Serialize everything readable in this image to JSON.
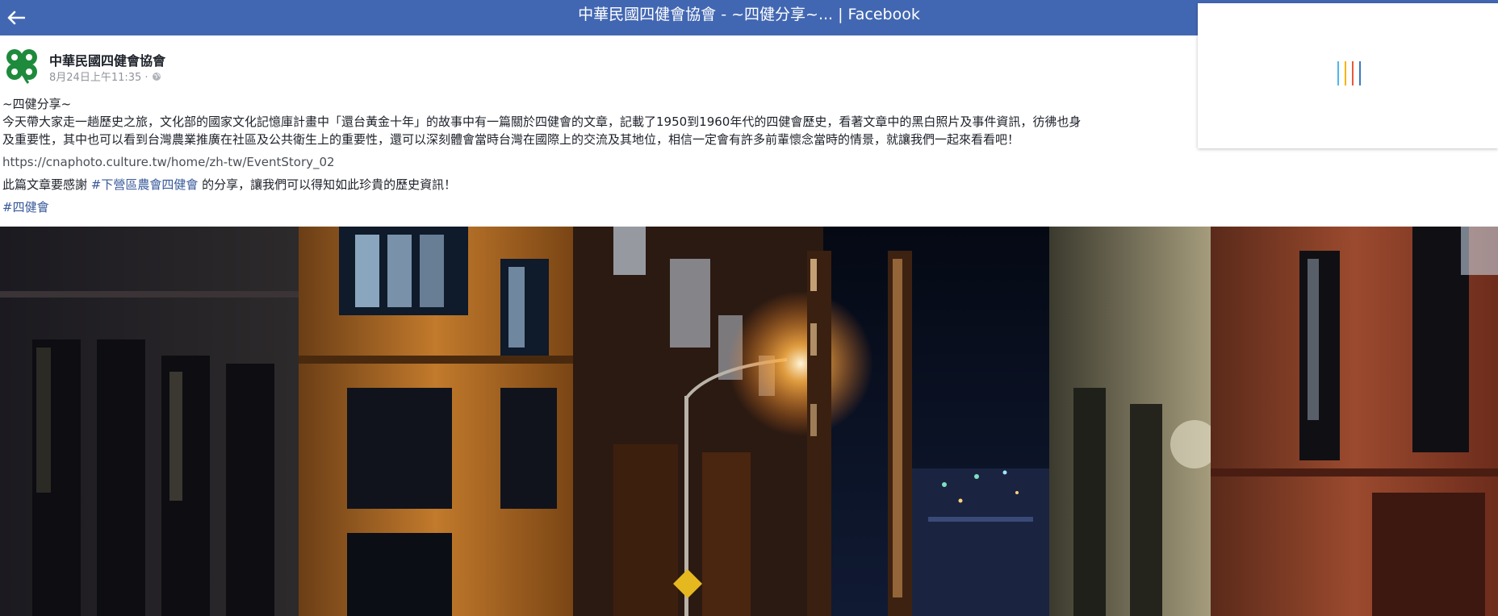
{
  "header": {
    "title": "中華民國四健會協會 - ~四健分享~... | Facebook",
    "back_icon": "back-arrow-icon"
  },
  "post": {
    "page_name": "中華民國四健會協會",
    "timestamp": "8月24日上午11:35 · ",
    "privacy_icon": "globe-icon",
    "avatar_icon": "four-leaf-clover-logo",
    "heading": "~四健分享~",
    "body_line_1": "今天帶大家走一趟歷史之旅，文化部的國家文化記憶庫計畫中「還台黃金十年」的故事中有一篇關於四健會的文章，記載了1950到1960年代的四健會歷史，看著文章中的黑白照片及事件資訊，彷彿也身",
    "body_line_2": "及重要性，其中也可以看到台灣農業推廣在社區及公共衛生上的重要性，還可以深刻體會當時台灣在國際上的交流及其地位，相信一定會有許多前輩懷念當時的情景，就讓我們一起來看看吧！",
    "url": "https://cnaphoto.culture.tw/home/zh-tw/EventStory_02",
    "thanks_prefix": "此篇文章要感謝 ",
    "thanks_tag": "#下營區農會四健會",
    "thanks_suffix": " 的分享，讓我們可以得知如此珍貴的歷史資訊！",
    "hashtag": "#四健會"
  },
  "loader": {
    "colors": [
      "#4cb8e8",
      "#f5b400",
      "#e8583f",
      "#3b79c6"
    ]
  },
  "colors": {
    "brand": "#4267b2",
    "link": "#365899"
  }
}
